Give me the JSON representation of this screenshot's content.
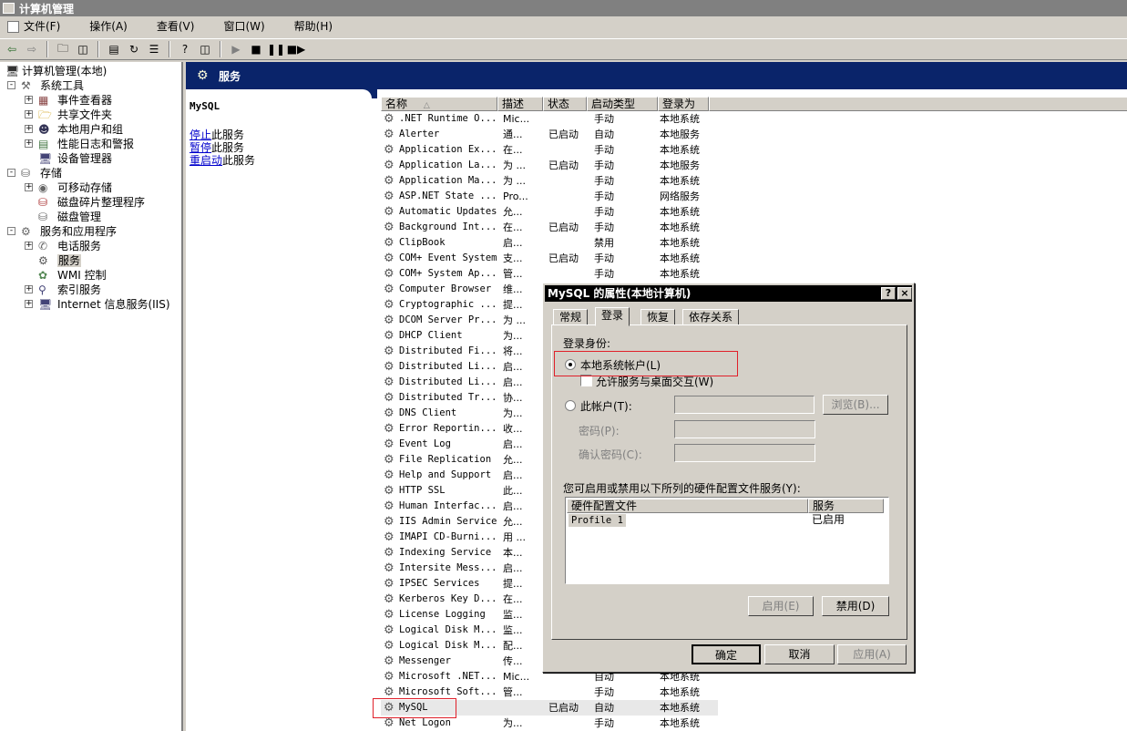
{
  "window": {
    "title": "计算机管理"
  },
  "menu": [
    "文件(F)",
    "操作(A)",
    "查看(V)",
    "窗口(W)",
    "帮助(H)"
  ],
  "tree": [
    {
      "label": "计算机管理(本地)"
    },
    {
      "label": "系统工具"
    },
    {
      "label": "事件查看器"
    },
    {
      "label": "共享文件夹"
    },
    {
      "label": "本地用户和组"
    },
    {
      "label": "性能日志和警报"
    },
    {
      "label": "设备管理器"
    },
    {
      "label": "存储"
    },
    {
      "label": "可移动存储"
    },
    {
      "label": "磁盘碎片整理程序"
    },
    {
      "label": "磁盘管理"
    },
    {
      "label": "服务和应用程序"
    },
    {
      "label": "电话服务"
    },
    {
      "label": "服务"
    },
    {
      "label": "WMI 控制"
    },
    {
      "label": "索引服务"
    },
    {
      "label": "Internet 信息服务(IIS)"
    }
  ],
  "pane": {
    "header": "服务",
    "selected_service": "MySQL",
    "actions": [
      {
        "link": "停止",
        "rest": "此服务"
      },
      {
        "link": "暂停",
        "rest": "此服务"
      },
      {
        "link": "重启动",
        "rest": "此服务"
      }
    ]
  },
  "list": {
    "columns": [
      "名称",
      "描述",
      "状态",
      "启动类型",
      "登录为"
    ],
    "rows": [
      [
        ".NET Runtime O...",
        "Mic...",
        "",
        "手动",
        "本地系统"
      ],
      [
        "Alerter",
        "通...",
        "已启动",
        "自动",
        "本地服务"
      ],
      [
        "Application Ex...",
        "在...",
        "",
        "手动",
        "本地系统"
      ],
      [
        "Application La...",
        "为 ...",
        "已启动",
        "手动",
        "本地服务"
      ],
      [
        "Application Ma...",
        "为 ...",
        "",
        "手动",
        "本地系统"
      ],
      [
        "ASP.NET State ...",
        "Pro...",
        "",
        "手动",
        "网络服务"
      ],
      [
        "Automatic Updates",
        "允...",
        "",
        "手动",
        "本地系统"
      ],
      [
        "Background Int...",
        "在...",
        "已启动",
        "手动",
        "本地系统"
      ],
      [
        "ClipBook",
        "启...",
        "",
        "禁用",
        "本地系统"
      ],
      [
        "COM+ Event System",
        "支...",
        "已启动",
        "手动",
        "本地系统"
      ],
      [
        "COM+ System Ap...",
        "管...",
        "",
        "手动",
        "本地系统"
      ],
      [
        "Computer Browser",
        "维...",
        "",
        "",
        ""
      ],
      [
        "Cryptographic ...",
        "提...",
        "",
        "",
        ""
      ],
      [
        "DCOM Server Pr...",
        "为 ...",
        "",
        "",
        ""
      ],
      [
        "DHCP Client",
        "为...",
        "",
        "",
        ""
      ],
      [
        "Distributed Fi...",
        "将...",
        "",
        "",
        ""
      ],
      [
        "Distributed Li...",
        "启...",
        "",
        "",
        ""
      ],
      [
        "Distributed Li...",
        "启...",
        "",
        "",
        ""
      ],
      [
        "Distributed Tr...",
        "协...",
        "",
        "",
        ""
      ],
      [
        "DNS Client",
        "为...",
        "",
        "",
        ""
      ],
      [
        "Error Reportin...",
        "收...",
        "",
        "",
        ""
      ],
      [
        "Event Log",
        "启...",
        "",
        "",
        ""
      ],
      [
        "File Replication",
        "允...",
        "",
        "",
        ""
      ],
      [
        "Help and Support",
        "启...",
        "",
        "",
        ""
      ],
      [
        "HTTP SSL",
        "此...",
        "",
        "",
        ""
      ],
      [
        "Human Interfac...",
        "启...",
        "",
        "",
        ""
      ],
      [
        "IIS Admin Service",
        "允...",
        "",
        "",
        ""
      ],
      [
        "IMAPI CD-Burni...",
        "用 ...",
        "",
        "",
        ""
      ],
      [
        "Indexing Service",
        "本...",
        "",
        "",
        ""
      ],
      [
        "Intersite Mess...",
        "启...",
        "",
        "",
        ""
      ],
      [
        "IPSEC Services",
        "提...",
        "",
        "",
        ""
      ],
      [
        "Kerberos Key D...",
        "在...",
        "",
        "",
        ""
      ],
      [
        "License Logging",
        "监...",
        "",
        "",
        ""
      ],
      [
        "Logical Disk M...",
        "监...",
        "",
        "",
        ""
      ],
      [
        "Logical Disk M...",
        "配...",
        "",
        "",
        ""
      ],
      [
        "Messenger",
        "传...",
        "",
        "",
        ""
      ],
      [
        "Microsoft .NET...",
        "Mic...",
        "",
        "自动",
        "本地系统"
      ],
      [
        "Microsoft Soft...",
        "管...",
        "",
        "手动",
        "本地系统"
      ],
      [
        "MySQL",
        "",
        "已启动",
        "自动",
        "本地系统"
      ],
      [
        "Net Logon",
        "为...",
        "",
        "手动",
        "本地系统"
      ]
    ]
  },
  "dialog": {
    "title": "MySQL 的属性(本地计算机)",
    "help_btn": "?",
    "close_btn": "×",
    "tabs": [
      "常规",
      "登录",
      "恢复",
      "依存关系"
    ],
    "logon_as": "登录身份:",
    "local_system": "本地系统帐户(L)",
    "allow_desktop": "允许服务与桌面交互(W)",
    "this_account": "此帐户(T):",
    "browse": "浏览(B)...",
    "password": "密码(P):",
    "confirm_password": "确认密码(C):",
    "hw_profile_text": "您可启用或禁用以下所列的硬件配置文件服务(Y):",
    "hw_columns": [
      "硬件配置文件",
      "服务"
    ],
    "hw_rows": [
      [
        "Profile 1",
        "已启用"
      ]
    ],
    "enable": "启用(E)",
    "disable": "禁用(D)",
    "ok": "确定",
    "cancel": "取消",
    "apply": "应用(A)"
  }
}
